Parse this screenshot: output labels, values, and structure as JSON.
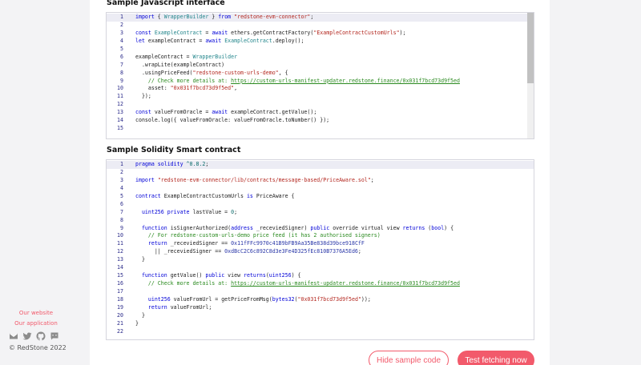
{
  "sidebar": {
    "links": [
      "Our website",
      "Our application"
    ],
    "social_icons": [
      "mail-icon",
      "twitter-icon",
      "github-icon",
      "discord-icon"
    ],
    "copyright": "© RedStone 2022"
  },
  "js_section": {
    "title": "Sample Javascript interface",
    "lines": [
      "import { WrapperBuilder } from \"redstone-evm-connector\";",
      "",
      "const ExampleContract = await ethers.getContractFactory(\"ExampleContractCustomUrls\");",
      "let exampleContract = await ExampleContract.deploy();",
      "",
      "exampleContract = WrapperBuilder",
      "  .wrapLite(exampleContract)",
      "  .usingPriceFeed(\"redstone-custom-urls-demo\", {",
      "    // Check more details at: https://custom-urls-manifest-updater.redstone.finance/0x031f7bcd73d9f5ed",
      "    asset: \"0x031f7bcd73d9f5ed\",",
      "  });",
      "",
      "const valueFromOracle = await exampleContract.getValue();",
      "console.log({ valueFromOracle: valueFromOracle.toNumber() });",
      ""
    ]
  },
  "sol_section": {
    "title": "Sample Solidity Smart contract",
    "lines": [
      "pragma solidity ^0.8.2;",
      "",
      "import \"redstone-evm-connector/lib/contracts/message-based/PriceAware.sol\";",
      "",
      "contract ExampleContractCustomUrls is PriceAware {",
      "",
      "  uint256 private lastValue = 0;",
      "",
      "  function isSignerAuthorized(address _receviedSigner) public override virtual view returns (bool) {",
      "    // For redstone-custom-urls-demo price feed (it has 2 authorised signers)",
      "    return _receviedSigner == 0x11fFFc9970c41B9bFB9Aa35Be838d39bce918CfF",
      "      || _receviedSigner == 0xdBcC2C6c892C8d3e3Fe4D325fEc810B7376A5Ed6;",
      "  }",
      "",
      "  function getValue() public view returns(uint256) {",
      "    // Check more details at: https://custom-urls-manifest-updater.redstone.finance/0x031f7bcd73d9f5ed",
      "",
      "    uint256 valueFromUrl = getPriceFromMsg(bytes32(\"0x031f7bcd73d9f5ed\"));",
      "    return valueFromUrl;",
      "  }",
      "}",
      ""
    ]
  },
  "buttons": {
    "hide_label": "Hide sample code",
    "test_label": "Test fetching now"
  }
}
